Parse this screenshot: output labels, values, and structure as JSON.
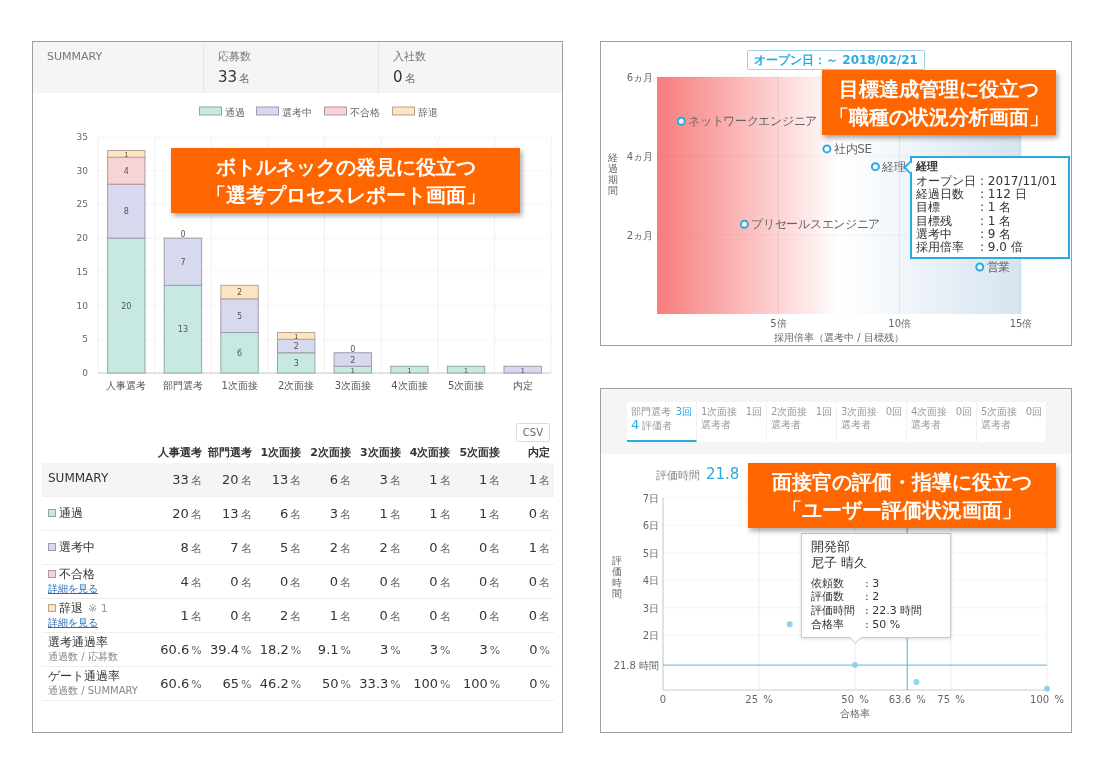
{
  "process_report": {
    "summary_header": {
      "title": "SUMMARY",
      "stats": [
        {
          "label": "応募数",
          "value": "33",
          "unit": "名"
        },
        {
          "label": "入社数",
          "value": "0",
          "unit": "名"
        }
      ]
    },
    "chart_data": {
      "type": "bar",
      "stacked": true,
      "grid": true,
      "legend": true,
      "categories": [
        "人事選考",
        "部門選考",
        "1次面接",
        "2次面接",
        "3次面接",
        "4次面接",
        "5次面接",
        "内定"
      ],
      "ylim": [
        0,
        35
      ],
      "yticks": [
        0,
        5,
        10,
        15,
        20,
        25,
        30,
        35
      ],
      "series": [
        {
          "name": "通過",
          "color": "#c8e9e2",
          "values": [
            20,
            13,
            6,
            3,
            1,
            1,
            1,
            0
          ],
          "value_labels": [
            "20",
            "13",
            "6",
            "3",
            "1",
            "1",
            "1",
            null
          ]
        },
        {
          "name": "選考中",
          "color": "#d7d9ef",
          "values": [
            8,
            7,
            5,
            2,
            2,
            0,
            0,
            1
          ],
          "value_labels": [
            "8",
            "7",
            "5",
            "2",
            "2",
            null,
            null,
            "1"
          ]
        },
        {
          "name": "不合格",
          "color": "#f6d3d5",
          "values": [
            4,
            0,
            0,
            0,
            0,
            0,
            0,
            0
          ],
          "value_labels": [
            "4",
            null,
            null,
            null,
            null,
            null,
            null,
            null
          ]
        },
        {
          "name": "辞退",
          "color": "#fde4c2",
          "values": [
            1,
            0,
            2,
            1,
            0,
            0,
            0,
            0
          ],
          "value_labels": [
            "1",
            "0",
            "2",
            "1",
            "0",
            null,
            null,
            null
          ]
        }
      ]
    },
    "csv_button": "CSV",
    "table": {
      "columns": [
        "人事選考",
        "部門選考",
        "1次面接",
        "2次面接",
        "3次面接",
        "4次面接",
        "5次面接",
        "内定"
      ],
      "rows": [
        {
          "kind": "summary",
          "label": "SUMMARY",
          "cells": [
            {
              "v": "33",
              "u": "名"
            },
            {
              "v": "20",
              "u": "名"
            },
            {
              "v": "13",
              "u": "名"
            },
            {
              "v": "6",
              "u": "名"
            },
            {
              "v": "3",
              "u": "名"
            },
            {
              "v": "1",
              "u": "名"
            },
            {
              "v": "1",
              "u": "名"
            },
            {
              "v": "1",
              "u": "名"
            }
          ]
        },
        {
          "kind": "status",
          "label": "通過",
          "color": "#c8e9e2",
          "cells": [
            {
              "v": "20",
              "u": "名"
            },
            {
              "v": "13",
              "u": "名"
            },
            {
              "v": "6",
              "u": "名"
            },
            {
              "v": "3",
              "u": "名"
            },
            {
              "v": "1",
              "u": "名"
            },
            {
              "v": "1",
              "u": "名"
            },
            {
              "v": "1",
              "u": "名"
            },
            {
              "v": "0",
              "u": "名"
            }
          ]
        },
        {
          "kind": "status",
          "label": "選考中",
          "color": "#d7d9ef",
          "cells": [
            {
              "v": "8",
              "u": "名"
            },
            {
              "v": "7",
              "u": "名"
            },
            {
              "v": "5",
              "u": "名"
            },
            {
              "v": "2",
              "u": "名"
            },
            {
              "v": "2",
              "u": "名"
            },
            {
              "v": "0",
              "u": "名"
            },
            {
              "v": "0",
              "u": "名"
            },
            {
              "v": "1",
              "u": "名"
            }
          ]
        },
        {
          "kind": "status",
          "label": "不合格",
          "color": "#f6d3d5",
          "link": "詳細を見る",
          "cells": [
            {
              "v": "4",
              "u": "名"
            },
            {
              "v": "0",
              "u": "名"
            },
            {
              "v": "0",
              "u": "名"
            },
            {
              "v": "0",
              "u": "名"
            },
            {
              "v": "0",
              "u": "名"
            },
            {
              "v": "0",
              "u": "名"
            },
            {
              "v": "0",
              "u": "名"
            },
            {
              "v": "0",
              "u": "名"
            }
          ]
        },
        {
          "kind": "status",
          "label": "辞退",
          "color": "#fde4c2",
          "note": "※ 1",
          "link": "詳細を見る",
          "cells": [
            {
              "v": "1",
              "u": "名"
            },
            {
              "v": "0",
              "u": "名"
            },
            {
              "v": "2",
              "u": "名"
            },
            {
              "v": "1",
              "u": "名"
            },
            {
              "v": "0",
              "u": "名"
            },
            {
              "v": "0",
              "u": "名"
            },
            {
              "v": "0",
              "u": "名"
            },
            {
              "v": "0",
              "u": "名"
            }
          ]
        },
        {
          "kind": "rate",
          "label": "選考通過率",
          "sub": "通過数 / 応募数",
          "cells": [
            {
              "v": "60.6",
              "u": "%"
            },
            {
              "v": "39.4",
              "u": "%"
            },
            {
              "v": "18.2",
              "u": "%"
            },
            {
              "v": "9.1",
              "u": "%"
            },
            {
              "v": "3",
              "u": "%"
            },
            {
              "v": "3",
              "u": "%"
            },
            {
              "v": "3",
              "u": "%"
            },
            {
              "v": "0",
              "u": "%"
            }
          ]
        },
        {
          "kind": "rate",
          "label": "ゲート通過率",
          "sub": "通過数 / SUMMARY",
          "cells": [
            {
              "v": "60.6",
              "u": "%"
            },
            {
              "v": "65",
              "u": "%"
            },
            {
              "v": "46.2",
              "u": "%"
            },
            {
              "v": "50",
              "u": "%"
            },
            {
              "v": "33.3",
              "u": "%"
            },
            {
              "v": "100",
              "u": "%"
            },
            {
              "v": "100",
              "u": "%"
            },
            {
              "v": "0",
              "u": "%"
            }
          ]
        }
      ]
    }
  },
  "job_analysis": {
    "date_badge": "オープン日：～ 2018/02/21",
    "chart_data": {
      "type": "scatter",
      "grid": true,
      "xlabel": "採用倍率（選考中 / 目標残）",
      "ylabel": "経過期間",
      "x": [
        1.0,
        3.6,
        7.0,
        9.0,
        13.3
      ],
      "xlim": [
        0,
        15
      ],
      "ylim": [
        0,
        6
      ],
      "series": [
        {
          "color": "#29abe2",
          "values": [
            4.88,
            2.27,
            4.18,
            3.73,
            1.19
          ]
        }
      ],
      "xticks": [
        {
          "value": 5,
          "label": "5倍"
        },
        {
          "value": 10,
          "label": "10倍"
        },
        {
          "value": 15,
          "label": "15倍"
        }
      ],
      "yticks": [
        {
          "value": 2,
          "label": "2ヵ月"
        },
        {
          "value": 4,
          "label": "4ヵ月"
        },
        {
          "value": 6,
          "label": "6ヵ月"
        }
      ],
      "annotations": [
        {
          "x": 1.0,
          "y": 4.88,
          "text": "ネットワークエンジニア"
        },
        {
          "x": 3.6,
          "y": 2.27,
          "text": "プリセールスエンジニア"
        },
        {
          "x": 7.0,
          "y": 4.18,
          "text": "社内SE"
        },
        {
          "x": 9.0,
          "y": 3.73,
          "text": "経理"
        },
        {
          "x": 13.3,
          "y": 1.19,
          "text": "営業"
        }
      ]
    },
    "tooltip": {
      "title": "経理",
      "rows": [
        {
          "label": "オープン日",
          "value": ": 2017/11/01"
        },
        {
          "label": "経過日数",
          "value": ": 112 日"
        },
        {
          "label": "目標",
          "value": ": 1 名"
        },
        {
          "label": "目標残",
          "value": ": 1 名"
        },
        {
          "label": "選考中",
          "value": ": 9 名"
        },
        {
          "label": "採用倍率",
          "value": ": 9.0 倍"
        }
      ]
    }
  },
  "rating_panel": {
    "tabs": [
      {
        "label": "部門選考",
        "count": "3回",
        "value": "4",
        "unit": "評価者",
        "selected": true
      },
      {
        "label": "1次面接",
        "sub": "選考者",
        "count": "1回",
        "selected": false
      },
      {
        "label": "2次面接",
        "sub": "選考者",
        "count": "1回",
        "selected": false
      },
      {
        "label": "3次面接",
        "sub": "選考者",
        "count": "0回",
        "selected": false
      },
      {
        "label": "4次面接",
        "sub": "選考者",
        "count": "0回",
        "selected": false
      },
      {
        "label": "5次面接",
        "sub": "選考者",
        "count": "0回",
        "selected": false
      }
    ],
    "metric": {
      "label": "評価時間",
      "value": "21.8"
    },
    "chart_data": {
      "type": "scatter",
      "grid": true,
      "xlabel": "合格率",
      "ylabel": "評価時間",
      "x": [
        33,
        50,
        66,
        100
      ],
      "xlim": [
        0,
        100
      ],
      "ylim": [
        0,
        7
      ],
      "series": [
        {
          "color": "#8fd3ec",
          "values": [
            2.4,
            0.91,
            0.29,
            0.05
          ]
        }
      ],
      "xticks": [
        {
          "value": 0,
          "label": "0"
        },
        {
          "value": 25,
          "label": "25 %"
        },
        {
          "value": 50,
          "label": "50 %"
        },
        {
          "value": 63.6,
          "label": "63.6 %"
        },
        {
          "value": 75,
          "label": "75 %"
        },
        {
          "value": 100,
          "label": "100 %"
        }
      ],
      "yticks": [
        {
          "value": 2,
          "label": "2日"
        },
        {
          "value": 3,
          "label": "3日"
        },
        {
          "value": 4,
          "label": "4日"
        },
        {
          "value": 5,
          "label": "5日"
        },
        {
          "value": 6,
          "label": "6日"
        },
        {
          "value": 7,
          "label": "7日"
        }
      ],
      "ref_lines": [
        {
          "axis": "x",
          "value": 63.6
        },
        {
          "axis": "y",
          "value": 0.908,
          "label": "21.8 時間"
        }
      ]
    },
    "tooltip": {
      "title_lines": [
        "開発部",
        "尼子 晴久"
      ],
      "rows": [
        {
          "label": "依頼数",
          "value": ": 3"
        },
        {
          "label": "評価数",
          "value": ": 2"
        },
        {
          "label": "評価時間",
          "value": ": 22.3 時間"
        },
        {
          "label": "合格率",
          "value": ": 50 %"
        }
      ]
    }
  },
  "callouts": [
    {
      "lines": [
        "ボトルネックの発見に役立つ",
        "「選考プロセスレポート画面」"
      ]
    },
    {
      "lines": [
        "目標達成管理に役立つ",
        "「職種の状況分析画面」"
      ]
    },
    {
      "lines": [
        "面接官の評価・指導に役立つ",
        "「ユーザー評価状況画面」"
      ]
    }
  ]
}
